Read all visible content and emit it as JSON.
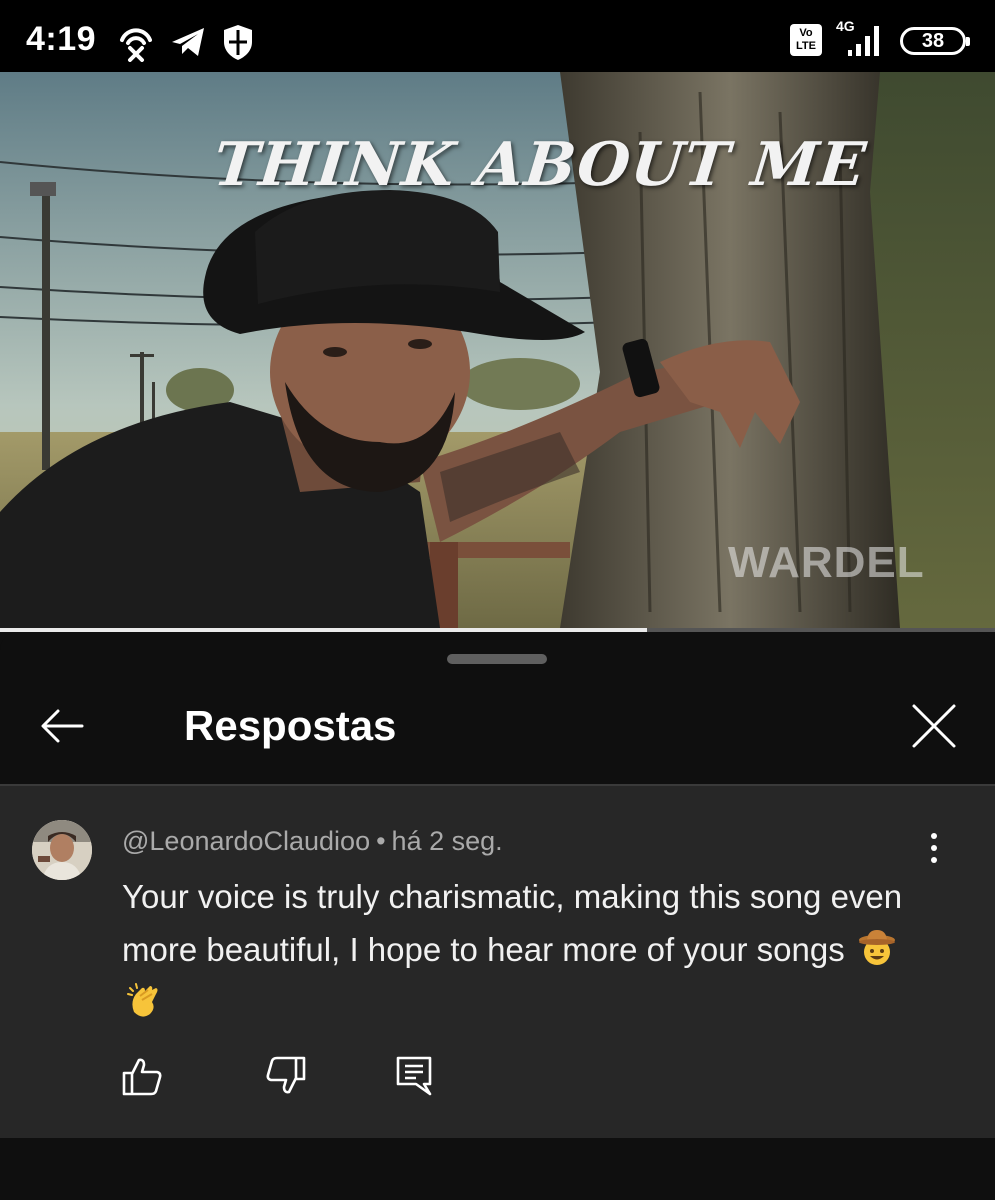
{
  "status_bar": {
    "time": "4:19",
    "network": "4G",
    "volte": "Vo LTE",
    "battery": "38",
    "icons": [
      "hotspot-icon",
      "telegram-icon",
      "shield-icon",
      "volte-icon",
      "signal-icon",
      "battery-icon"
    ]
  },
  "video": {
    "title": "THINK ABOUT ME",
    "watermark": "WARDEL",
    "progress": 0.65
  },
  "panel": {
    "title": "Respostas",
    "back_icon": "arrow-left-icon",
    "close_icon": "close-icon"
  },
  "comment": {
    "author": "@LeonardoClaudioo",
    "separator": "•",
    "time": "há 2 seg.",
    "text": "Your voice is truly charismatic, making this song even more beautiful, I hope to hear more of your songs",
    "emojis": [
      "cowboy-face-emoji",
      "clapping-hands-emoji"
    ],
    "actions": [
      "like-icon",
      "dislike-icon",
      "reply-icon"
    ]
  },
  "colors": {
    "background": "#0f0f0f",
    "card": "#272727",
    "meta_text": "#aaaaaa",
    "body_text": "#f1f1f1"
  }
}
